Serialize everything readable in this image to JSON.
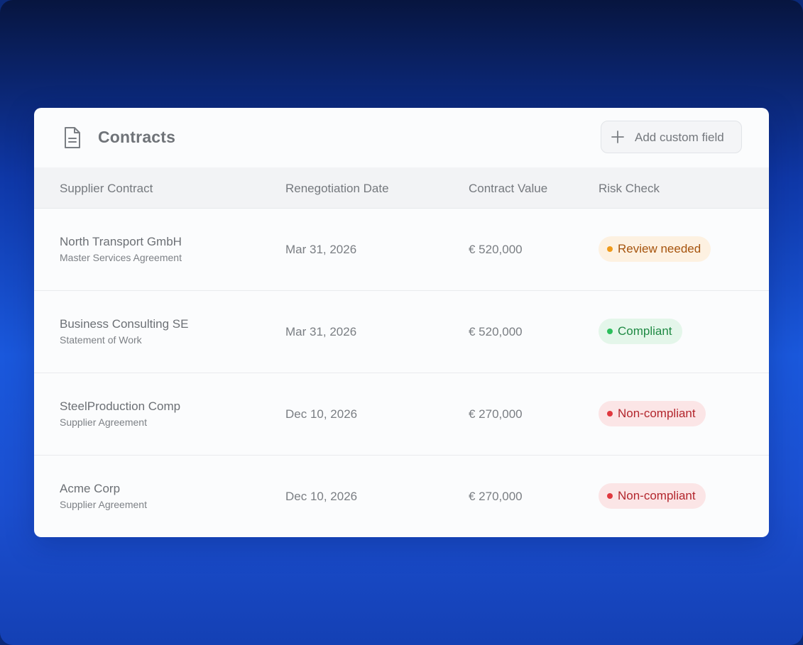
{
  "header": {
    "title": "Contracts",
    "add_button_label": "Add custom field"
  },
  "columns": {
    "supplier": "Supplier Contract",
    "date": "Renegotiation Date",
    "value": "Contract Value",
    "risk": "Risk Check"
  },
  "rows": [
    {
      "name": "North Transport GmbH",
      "type": "Master Services Agreement",
      "date": "Mar 31, 2026",
      "value": "€ 520,000",
      "risk": "Review needed",
      "risk_status": "review"
    },
    {
      "name": "Business Consulting SE",
      "type": "Statement of Work",
      "date": "Mar 31, 2026",
      "value": "€ 520,000",
      "risk": "Compliant",
      "risk_status": "ok"
    },
    {
      "name": "SteelProduction Comp",
      "type": "Supplier Agreement",
      "date": "Dec 10, 2026",
      "value": "€ 270,000",
      "risk": "Non-compliant",
      "risk_status": "bad"
    },
    {
      "name": "Acme Corp",
      "type": "Supplier Agreement",
      "date": "Dec 10, 2026",
      "value": "€ 270,000",
      "risk": "Non-compliant",
      "risk_status": "bad"
    }
  ],
  "icons": {
    "header": "document-icon",
    "add": "plus-icon"
  },
  "colors": {
    "review": "#ef9a1a",
    "compliant": "#2cbf5c",
    "non_compliant": "#e0383f"
  }
}
